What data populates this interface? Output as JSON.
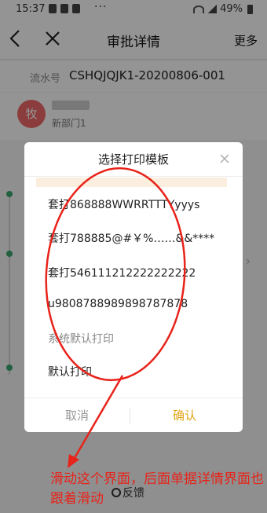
{
  "status": {
    "time": "15:37",
    "dots": "···",
    "battery": "49%"
  },
  "nav": {
    "title": "审批详情",
    "more": "更多"
  },
  "detail": {
    "serial_label": "流水号",
    "serial_value": "CSHQJQJK1-20200806-001",
    "avatar_text": "牧",
    "department": "新部门1",
    "bottom_action": "反馈"
  },
  "dialog": {
    "title": "选择打印模板",
    "options": [
      "套打868888WWRRTTTYyyys",
      "套打788885@#￥%……&&****",
      "套打546111212222222222",
      "u9808788989898787878",
      "系统默认打印",
      "默认打印"
    ],
    "cancel": "取消",
    "confirm": "确认"
  },
  "annotation": {
    "text": "滑动这个界面，后面单据详情界面也跟着滑动",
    "color": "#e8231a"
  },
  "colors": {
    "accent": "#e0a418",
    "avatar": "#ef6a6a",
    "timeline": "#3aa76d"
  }
}
